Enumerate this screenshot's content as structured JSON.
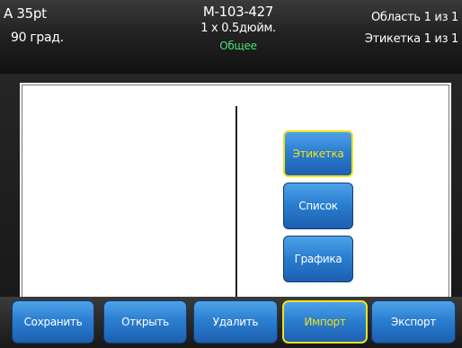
{
  "status": {
    "font": "A 35pt",
    "rotation": "90 град.",
    "label_id": "M-103-427",
    "label_size": "1 x 0.5дюйм.",
    "label_type": "Общее",
    "area": "Область 1 из 1",
    "label_count": "Этикетка 1 из 1"
  },
  "side_buttons": [
    {
      "label": "Этикетка",
      "selected": true
    },
    {
      "label": "Список",
      "selected": false
    },
    {
      "label": "Графика",
      "selected": false
    }
  ],
  "bottom_buttons": [
    {
      "label": "Сохранить",
      "selected": false
    },
    {
      "label": "Открыть",
      "selected": false
    },
    {
      "label": "Удалить",
      "selected": false
    },
    {
      "label": "Импорт",
      "selected": true
    },
    {
      "label": "Экспорт",
      "selected": false
    }
  ],
  "colors": {
    "accent_selected": "#f0e21b",
    "button_blue": "#2b7fd1",
    "label_type_green": "#49e07a"
  }
}
